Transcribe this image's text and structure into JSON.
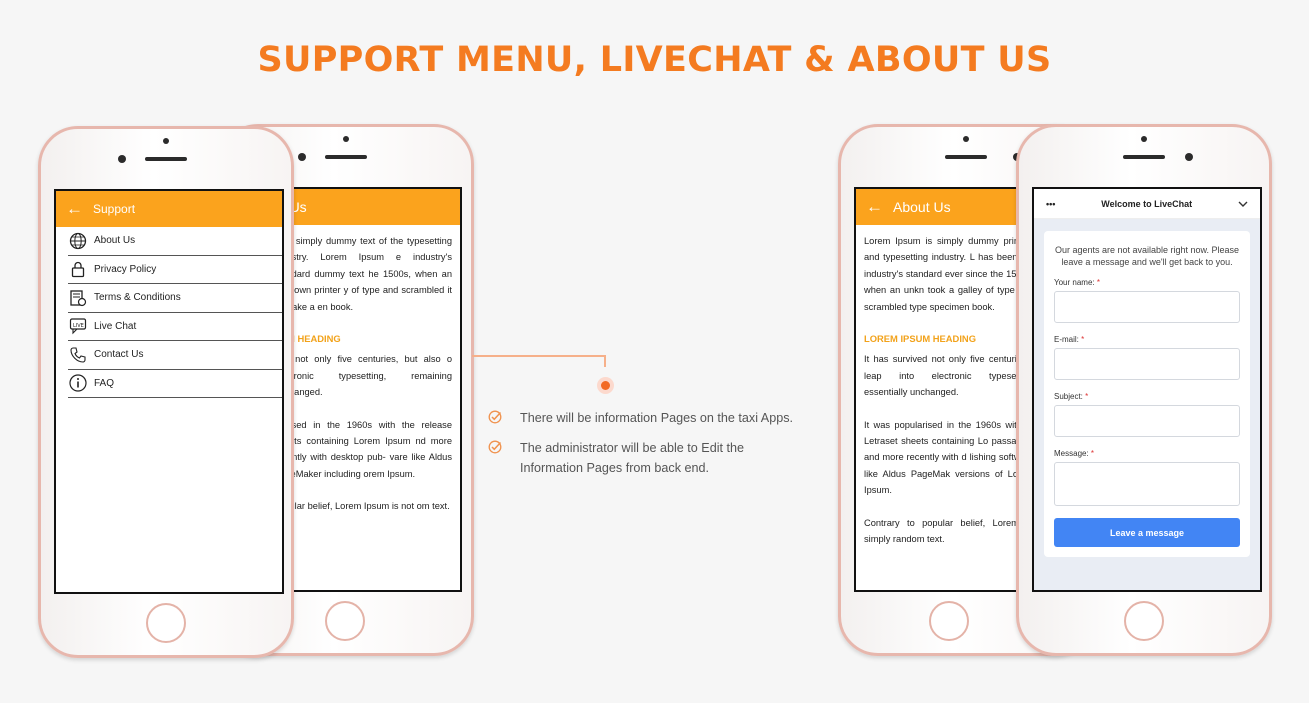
{
  "headline": "SUPPORT MENU, LIVECHAT & ABOUT US",
  "colors": {
    "accent": "#f47b20",
    "appbar": "#fba31d",
    "heading": "#f2a21a",
    "chat_button": "#4285f4"
  },
  "support": {
    "title": "Support",
    "items": [
      {
        "label": "About Us",
        "icon": "globe-icon"
      },
      {
        "label": "Privacy Policy",
        "icon": "lock-icon"
      },
      {
        "label": "Terms & Conditions",
        "icon": "document-icon"
      },
      {
        "label": "Live Chat",
        "icon": "live-chat-icon"
      },
      {
        "label": "Contact Us",
        "icon": "phone-icon"
      },
      {
        "label": "FAQ",
        "icon": "info-icon"
      }
    ]
  },
  "about_back": {
    "title": "ut Us",
    "p1": "m is simply dummy text of the typesetting industry. Lorem Ipsum e industry's standard dummy text he 1500s, when an unknown printer y of type and scrambled it to make a en book.",
    "heading": "SUM HEADING",
    "p2": "ved not only five centuries, but also o electronic typesetting, remaining unchanged.",
    "p3": "ularised in the 1960s with the release sheets containing Lorem Ipsum nd more recently with desktop pub- vare like Aldus PageMaker including orem Ipsum.",
    "p4": "popular belief, Lorem Ipsum is not om text."
  },
  "about_front": {
    "title": "About Us",
    "p1": "Lorem Ipsum is simply dummy printing and typesetting industry. L has been the industry's standard ever since the 1500s, when an unkn took a galley of type and scrambled type specimen book.",
    "heading": "LOREM IPSUM HEADING",
    "p2": "It has survived not only five centuri the leap into electronic typesetting essentially unchanged.",
    "p3": "It was popularised in the 1960s with of Letraset sheets containing Lo passages, and more recently with d lishing software like Aldus PageMak versions of Lorem Ipsum.",
    "p4": "Contrary to popular belief, Lorem Ip simply random text."
  },
  "bullets": [
    "There will be information Pages on the taxi Apps.",
    "The administrator will be able to Edit the Information Pages from back end."
  ],
  "livechat": {
    "title": "Welcome to LiveChat",
    "note": "Our agents are not available right now. Please leave a message and we'll get back to you.",
    "name_label": "Your name:",
    "email_label": "E-mail:",
    "subject_label": "Subject:",
    "message_label": "Message:",
    "required_mark": "*",
    "button": "Leave a message"
  }
}
